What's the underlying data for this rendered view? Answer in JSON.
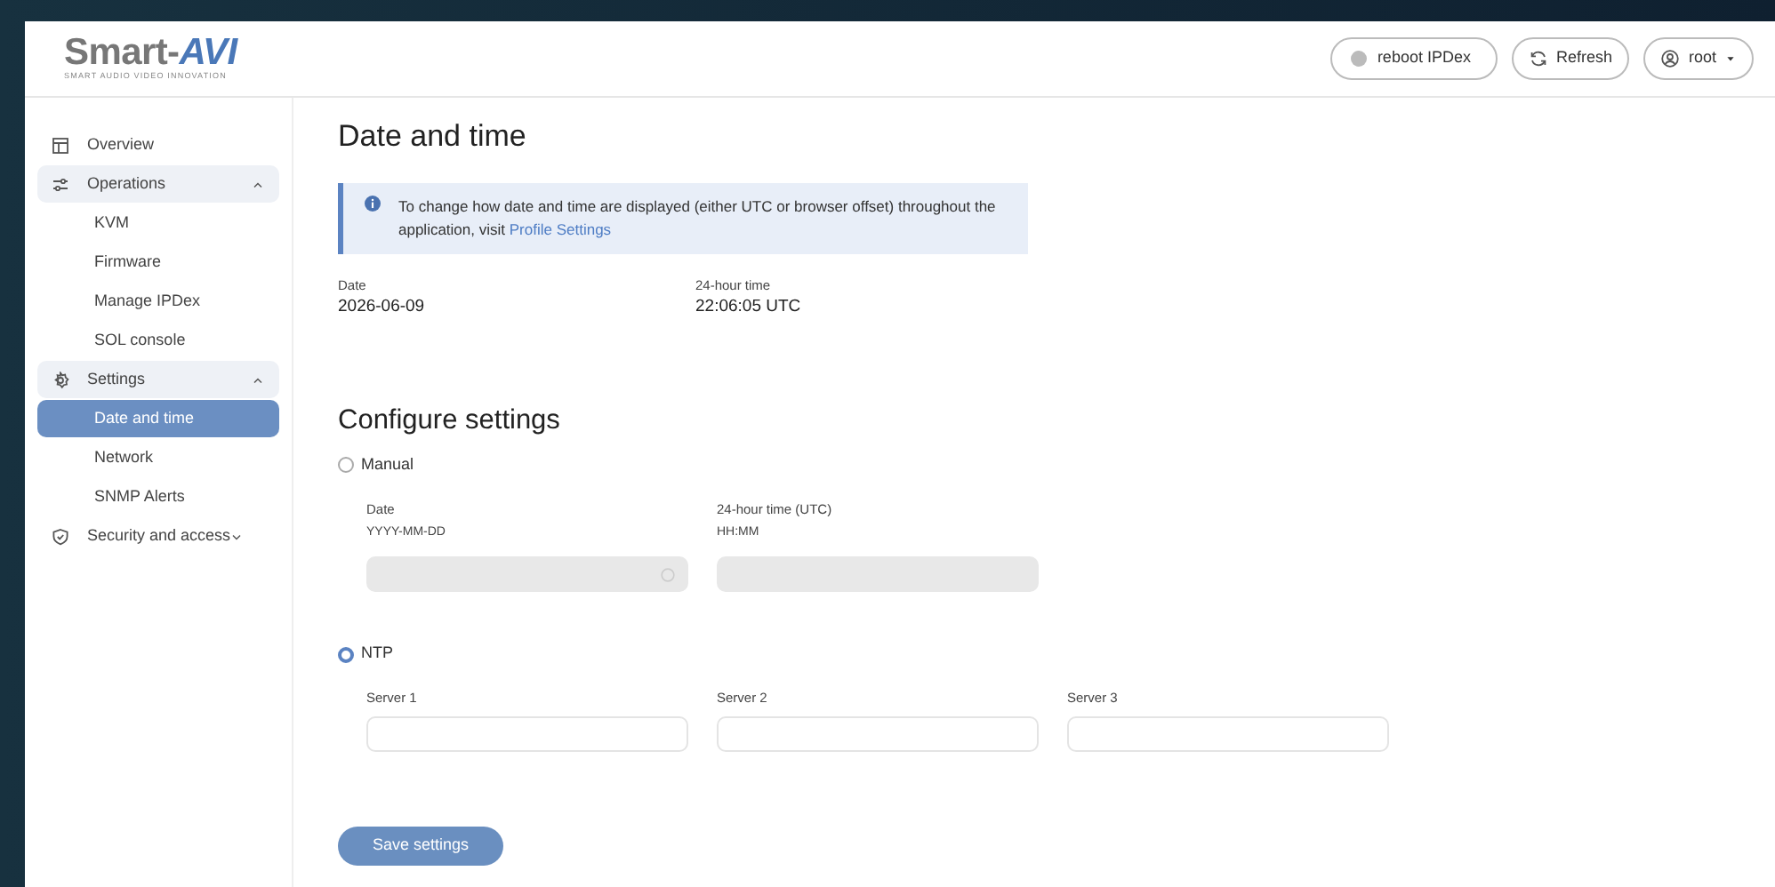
{
  "logo": {
    "name": "Smart-",
    "accent": "AVI",
    "tagline": "SMART AUDIO VIDEO INNOVATION"
  },
  "header_buttons": [
    {
      "kind": "reboot",
      "label": "reboot IPDex"
    },
    {
      "kind": "refresh",
      "label": "Refresh"
    },
    {
      "kind": "user",
      "label": "root"
    }
  ],
  "sidebar": {
    "items": [
      {
        "kind": "overview",
        "label": "Overview"
      },
      {
        "kind": "operations",
        "label": "Operations",
        "expanded": true,
        "children": [
          {
            "label": "KVM",
            "selected": false
          },
          {
            "label": "Firmware",
            "selected": false
          },
          {
            "label": "Manage IPDex",
            "selected": false
          },
          {
            "label": "SOL console",
            "selected": false
          }
        ]
      },
      {
        "kind": "settings",
        "label": "Settings",
        "expanded": true,
        "children": [
          {
            "label": "Date and time",
            "selected": true
          },
          {
            "label": "Network",
            "selected": false
          },
          {
            "label": "SNMP Alerts",
            "selected": false
          }
        ]
      },
      {
        "kind": "security",
        "label": "Security and access",
        "expanded": false
      }
    ]
  },
  "page_title": "Date and time",
  "info": {
    "text": "To change how date and time are displayed (either UTC or browser offset) throughout the application, visit",
    "link": "Profile Settings"
  },
  "current": [
    {
      "label": "Date",
      "value": "2026-06-09"
    },
    {
      "label": "24-hour time",
      "value": "22:06:05 UTC"
    }
  ],
  "configure_title": "Configure settings",
  "modes": [
    {
      "label": "Manual",
      "selected": false,
      "fields": [
        {
          "label": "Date",
          "hint": "YYYY-MM-DD",
          "kind": "date"
        },
        {
          "label": "24-hour time (UTC)",
          "hint": "HH:MM",
          "kind": "time"
        }
      ]
    },
    {
      "label": "NTP",
      "selected": true,
      "fields": [
        {
          "label": "Server 1"
        },
        {
          "label": "Server 2"
        },
        {
          "label": "Server 3"
        }
      ]
    }
  ],
  "save_button": "Save settings"
}
